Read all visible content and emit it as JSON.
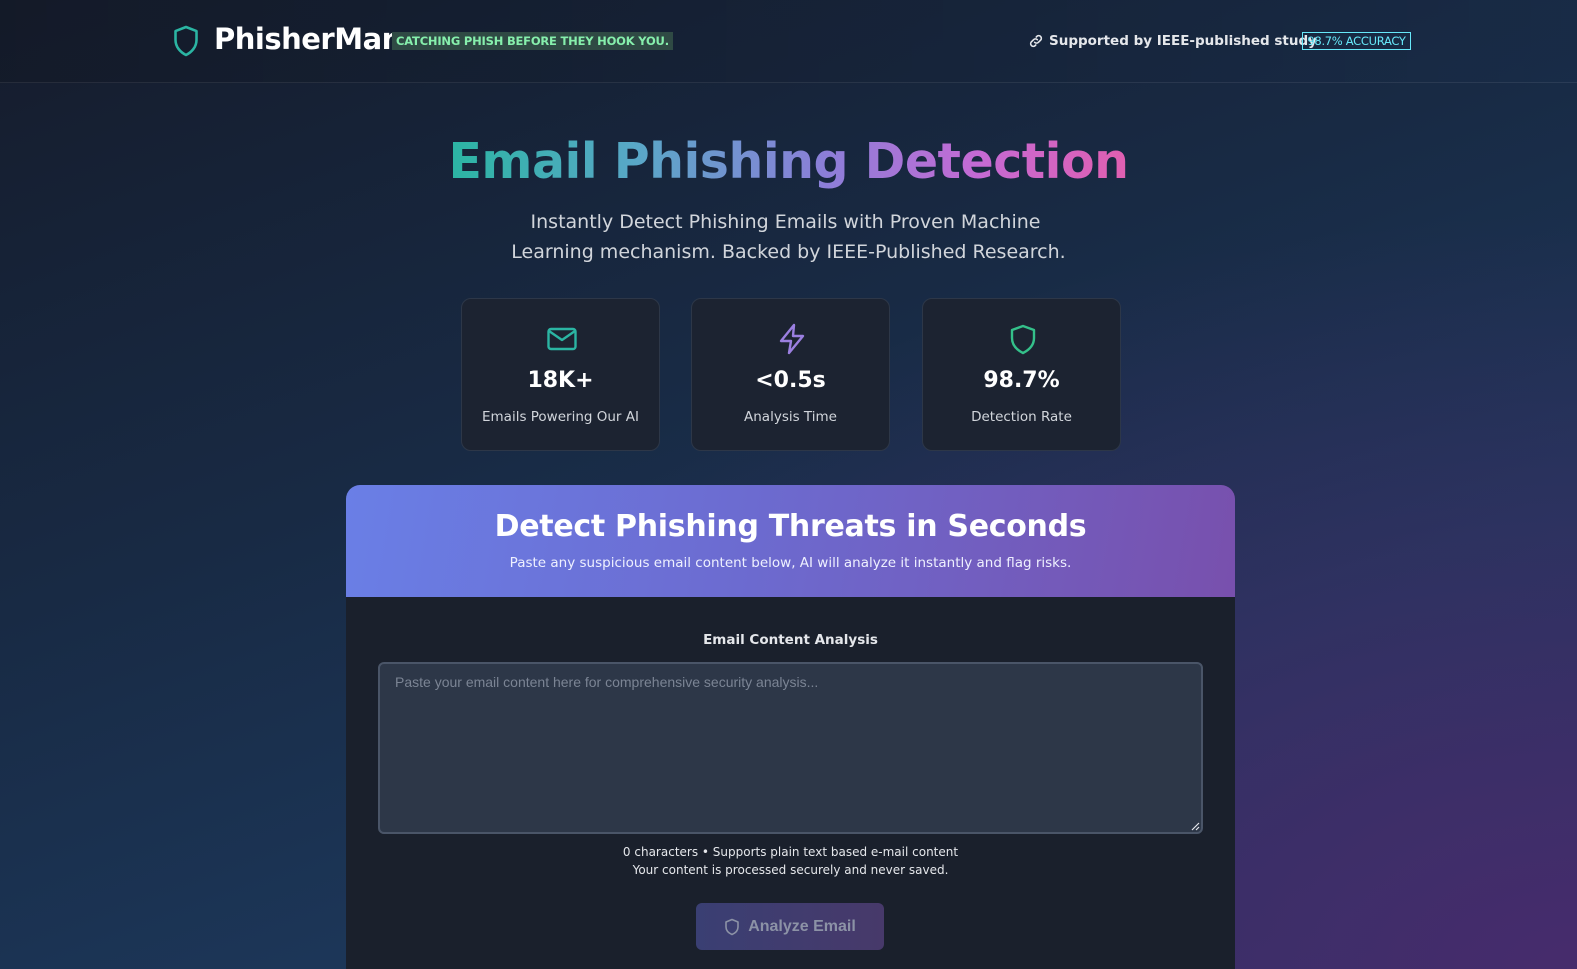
{
  "header": {
    "brand_name": "PhisherMan",
    "brand_icon": "shield-icon",
    "tagline": "CATCHING PHISH BEFORE THEY HOOK YOU.",
    "ieee_link": "Supported by IEEE-published study",
    "ieee_icon": "link-icon",
    "accuracy_badge": "98.7% ACCURACY"
  },
  "hero": {
    "title": "Email Phishing Detection",
    "subtitle_line1": "Instantly Detect Phishing Emails with Proven Machine",
    "subtitle_line2": "Learning mechanism. Backed by IEEE-Published Research."
  },
  "stats": [
    {
      "icon": "mail-icon",
      "value": "18K+",
      "label": "Emails Powering Our AI",
      "color": "#2bb5a3"
    },
    {
      "icon": "lightning-icon",
      "value": "<0.5s",
      "label": "Analysis Time",
      "color": "#9b7fe0"
    },
    {
      "icon": "shield-icon",
      "value": "98.7%",
      "label": "Detection Rate",
      "color": "#34c08a"
    }
  ],
  "panel": {
    "title": "Detect Phishing Threats in Seconds",
    "description": "Paste any suspicious email content below, AI will analyze it instantly and flag risks.",
    "field_label": "Email Content Analysis",
    "input_value": "",
    "input_placeholder": "Paste your email content here for comprehensive security analysis...",
    "char_info": "0 characters • Supports plain text based e-mail content",
    "privacy_note": "Your content is processed securely and never saved.",
    "analyze_button": "Analyze Email"
  },
  "colors": {
    "accent_teal": "#2bb5a3",
    "accent_purple": "#8b7fd8",
    "accent_pink": "#e05fb0",
    "badge_green": "#86efac",
    "badge_cyan": "#67e8f9"
  }
}
